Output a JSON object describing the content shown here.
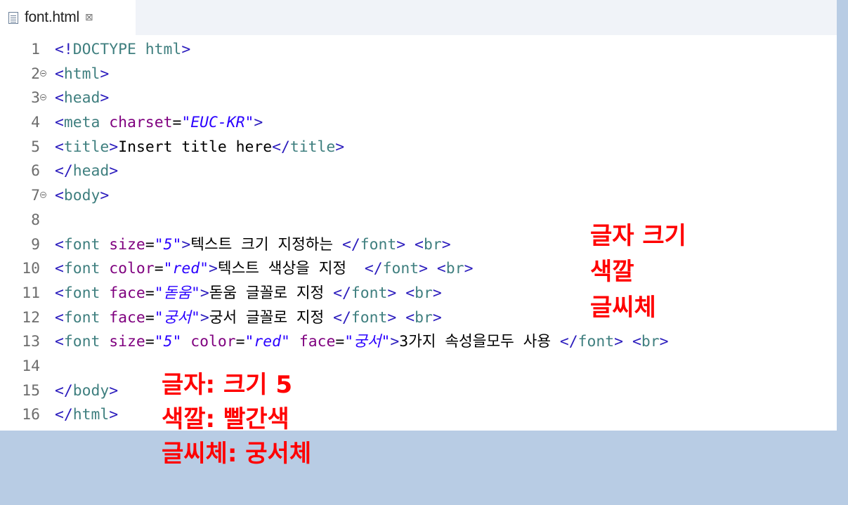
{
  "tab": {
    "icon": "html-file-icon",
    "label": "font.html",
    "close_glyph": "⊠"
  },
  "lines": [
    {
      "num": "1",
      "fold": false,
      "segments": [
        [
          "tg",
          "<!"
        ],
        [
          "tn",
          "DOCTYPE html"
        ],
        [
          "tg",
          ">"
        ]
      ]
    },
    {
      "num": "2",
      "fold": true,
      "segments": [
        [
          "tg",
          "<"
        ],
        [
          "tn",
          "html"
        ],
        [
          "tg",
          ">"
        ]
      ]
    },
    {
      "num": "3",
      "fold": true,
      "segments": [
        [
          "tg",
          "<"
        ],
        [
          "tn",
          "head"
        ],
        [
          "tg",
          ">"
        ]
      ]
    },
    {
      "num": "4",
      "fold": false,
      "segments": [
        [
          "tg",
          "<"
        ],
        [
          "tn",
          "meta"
        ],
        [
          "ct",
          " "
        ],
        [
          "an",
          "charset"
        ],
        [
          "ct",
          "="
        ],
        [
          "av",
          "\"EUC-KR\""
        ],
        [
          "tg",
          ">"
        ]
      ]
    },
    {
      "num": "5",
      "fold": false,
      "segments": [
        [
          "tg",
          "<"
        ],
        [
          "tn",
          "title"
        ],
        [
          "tg",
          ">"
        ],
        [
          "ct",
          "Insert title here"
        ],
        [
          "tg",
          "</"
        ],
        [
          "tn",
          "title"
        ],
        [
          "tg",
          ">"
        ]
      ]
    },
    {
      "num": "6",
      "fold": false,
      "segments": [
        [
          "tg",
          "</"
        ],
        [
          "tn",
          "head"
        ],
        [
          "tg",
          ">"
        ]
      ]
    },
    {
      "num": "7",
      "fold": true,
      "segments": [
        [
          "tg",
          "<"
        ],
        [
          "tn",
          "body"
        ],
        [
          "tg",
          ">"
        ]
      ]
    },
    {
      "num": "8",
      "fold": false,
      "segments": []
    },
    {
      "num": "9",
      "fold": false,
      "segments": [
        [
          "tg",
          "<"
        ],
        [
          "tn",
          "font"
        ],
        [
          "ct",
          " "
        ],
        [
          "an",
          "size"
        ],
        [
          "ct",
          "="
        ],
        [
          "av",
          "\"5\""
        ],
        [
          "tg",
          ">"
        ],
        [
          "ct",
          "텍스트 크기 지정하는 "
        ],
        [
          "tg",
          "</"
        ],
        [
          "tn",
          "font"
        ],
        [
          "tg",
          ">"
        ],
        [
          "ct",
          " "
        ],
        [
          "tg",
          "<"
        ],
        [
          "tn",
          "br"
        ],
        [
          "tg",
          ">"
        ]
      ]
    },
    {
      "num": "10",
      "fold": false,
      "segments": [
        [
          "tg",
          "<"
        ],
        [
          "tn",
          "font"
        ],
        [
          "ct",
          " "
        ],
        [
          "an",
          "color"
        ],
        [
          "ct",
          "="
        ],
        [
          "av",
          "\"red\""
        ],
        [
          "tg",
          ">"
        ],
        [
          "ct",
          "텍스트 색상을 지정  "
        ],
        [
          "tg",
          "</"
        ],
        [
          "tn",
          "font"
        ],
        [
          "tg",
          ">"
        ],
        [
          "ct",
          " "
        ],
        [
          "tg",
          "<"
        ],
        [
          "tn",
          "br"
        ],
        [
          "tg",
          ">"
        ]
      ]
    },
    {
      "num": "11",
      "fold": false,
      "segments": [
        [
          "tg",
          "<"
        ],
        [
          "tn",
          "font"
        ],
        [
          "ct",
          " "
        ],
        [
          "an",
          "face"
        ],
        [
          "ct",
          "="
        ],
        [
          "av",
          "\"돋움\""
        ],
        [
          "tg",
          ">"
        ],
        [
          "ct",
          "돋움 글꼴로 지정 "
        ],
        [
          "tg",
          "</"
        ],
        [
          "tn",
          "font"
        ],
        [
          "tg",
          ">"
        ],
        [
          "ct",
          " "
        ],
        [
          "tg",
          "<"
        ],
        [
          "tn",
          "br"
        ],
        [
          "tg",
          ">"
        ]
      ]
    },
    {
      "num": "12",
      "fold": false,
      "segments": [
        [
          "tg",
          "<"
        ],
        [
          "tn",
          "font"
        ],
        [
          "ct",
          " "
        ],
        [
          "an",
          "face"
        ],
        [
          "ct",
          "="
        ],
        [
          "av",
          "\"궁서\""
        ],
        [
          "tg",
          ">"
        ],
        [
          "ct",
          "궁서 글꼴로 지정 "
        ],
        [
          "tg",
          "</"
        ],
        [
          "tn",
          "font"
        ],
        [
          "tg",
          ">"
        ],
        [
          "ct",
          " "
        ],
        [
          "tg",
          "<"
        ],
        [
          "tn",
          "br"
        ],
        [
          "tg",
          ">"
        ]
      ]
    },
    {
      "num": "13",
      "fold": false,
      "segments": [
        [
          "tg",
          "<"
        ],
        [
          "tn",
          "font"
        ],
        [
          "ct",
          " "
        ],
        [
          "an",
          "size"
        ],
        [
          "ct",
          "="
        ],
        [
          "av",
          "\"5\""
        ],
        [
          "ct",
          " "
        ],
        [
          "an",
          "color"
        ],
        [
          "ct",
          "="
        ],
        [
          "av",
          "\"red\""
        ],
        [
          "ct",
          " "
        ],
        [
          "an",
          "face"
        ],
        [
          "ct",
          "="
        ],
        [
          "av",
          "\"궁서\""
        ],
        [
          "tg",
          ">"
        ],
        [
          "ct",
          "3가지 속성을모두 사용 "
        ],
        [
          "tg",
          "</"
        ],
        [
          "tn",
          "font"
        ],
        [
          "tg",
          ">"
        ],
        [
          "ct",
          " "
        ],
        [
          "tg",
          "<"
        ],
        [
          "tn",
          "br"
        ],
        [
          "tg",
          ">"
        ]
      ]
    },
    {
      "num": "14",
      "fold": false,
      "segments": []
    },
    {
      "num": "15",
      "fold": false,
      "segments": [
        [
          "tg",
          "</"
        ],
        [
          "tn",
          "body"
        ],
        [
          "tg",
          ">"
        ]
      ]
    },
    {
      "num": "16",
      "fold": false,
      "segments": [
        [
          "tg",
          "</"
        ],
        [
          "tn",
          "html"
        ],
        [
          "tg",
          ">"
        ]
      ]
    }
  ],
  "annotations": {
    "size_note": "글자 크기",
    "color_note": "색깔",
    "face_note": "글씨체",
    "summary_size": "글자: 크기 5",
    "summary_color": "색깔: 빨간색",
    "summary_face": "글씨체: 궁서체"
  },
  "colors": {
    "background": "#b8cce4",
    "tag": "#2b1cbd",
    "tag_name": "#3f7f7f",
    "attr_name": "#7f007f",
    "attr_value": "#2a00ff",
    "annotation": "#ff0000"
  }
}
